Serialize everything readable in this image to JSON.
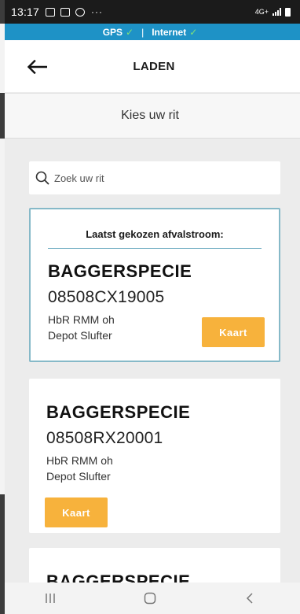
{
  "status_bar": {
    "time": "13:17",
    "dots": "···",
    "net_label": "4G+"
  },
  "connectivity": {
    "gps_label": "GPS",
    "separator": "|",
    "internet_label": "Internet",
    "ok_color": "#7fe07a",
    "bar_color": "#1e92c6"
  },
  "header": {
    "title": "LADEN",
    "back_icon": "arrow-left-icon"
  },
  "subheader": {
    "title": "Kies uw rit"
  },
  "search": {
    "placeholder": "Zoek uw rit",
    "icon": "search-icon"
  },
  "last_selected": {
    "heading": "Laatst gekozen afvalstroom:",
    "stream": "BAGGERSPECIE",
    "rit_number": "08508CX19005",
    "location_line1": "HbR RMM oh",
    "location_line2": "Depot Slufter",
    "button_label": "Kaart"
  },
  "rides": [
    {
      "stream": "BAGGERSPECIE",
      "rit_number": "08508RX20001",
      "location_line1": "HbR RMM oh",
      "location_line2": "Depot Slufter",
      "button_label": "Kaart"
    },
    {
      "stream": "BAGGERSPECIE"
    }
  ],
  "nav": {
    "recents": "III",
    "home": "○",
    "back": "<"
  },
  "colors": {
    "accent_button": "#f7b23c",
    "highlight_border": "#86b9c8"
  }
}
